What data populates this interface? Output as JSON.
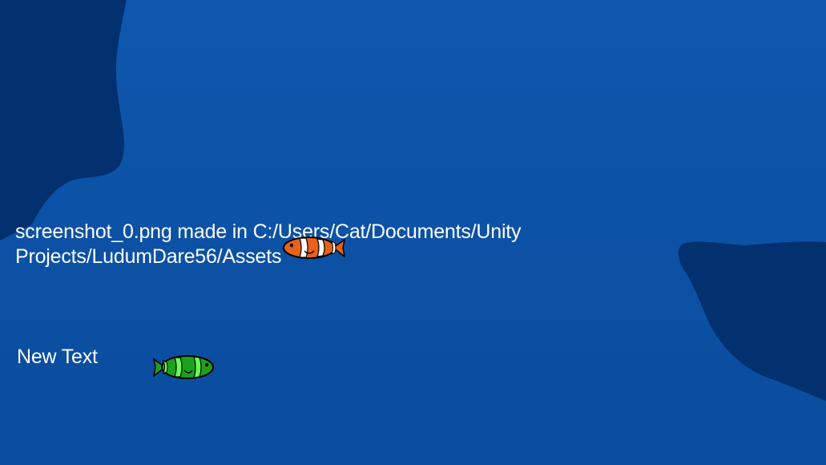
{
  "game": {
    "status_message": "screenshot_0.png made in C:/Users/Cat/Documents/Unity\nProjects/LudumDare56/Assets",
    "label_text": "New Text"
  },
  "colors": {
    "water": "#0c52a6",
    "rock_shadow": "#03306e",
    "text": "#ffffff",
    "clownfish_orange": "#e8621a",
    "clownfish_green": "#1ea01e"
  },
  "sprites": {
    "fish_1": "clownfish-orange",
    "fish_2": "clownfish-green"
  }
}
